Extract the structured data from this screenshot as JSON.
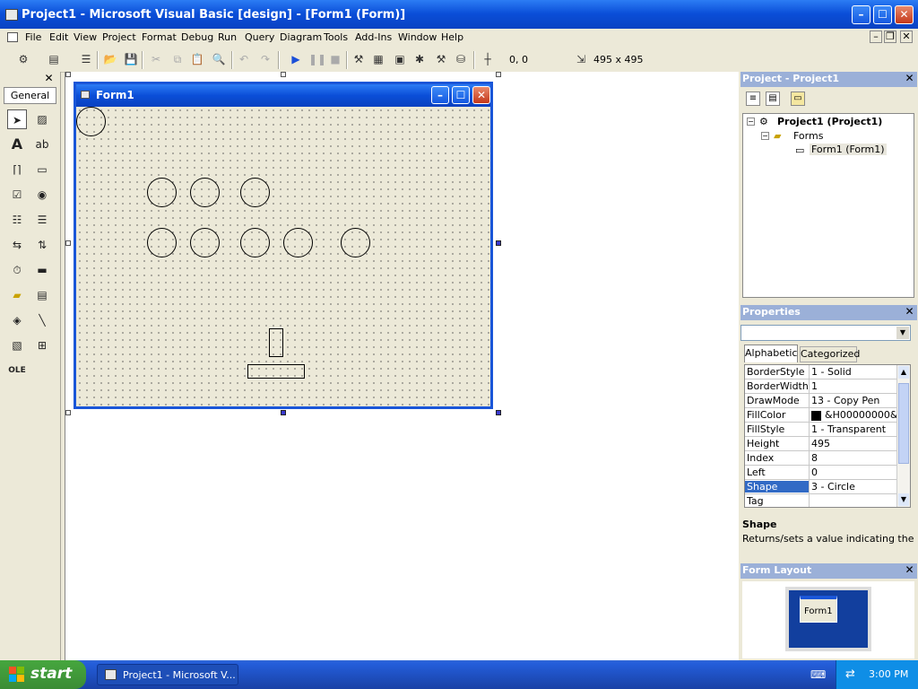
{
  "app": {
    "title": "Project1 - Microsoft Visual Basic [design] - [Form1 (Form)]",
    "minimize": "–",
    "maximize": "☐",
    "close": "✕"
  },
  "menubar": {
    "items": [
      "File",
      "Edit",
      "View",
      "Project",
      "Format",
      "Debug",
      "Run",
      "Query",
      "Diagram",
      "Tools",
      "Add-Ins",
      "Window",
      "Help"
    ],
    "mdi_controls": [
      "–",
      "❐",
      "✕"
    ]
  },
  "toolbar": {
    "position": "0, 0",
    "size": "495 x 495"
  },
  "toolbox": {
    "tab": "General",
    "close": "✕"
  },
  "form": {
    "title": "Form1",
    "minimize": "–",
    "maximize": "☐",
    "close": "✕"
  },
  "project_panel": {
    "title": "Project - Project1",
    "close": "✕",
    "root": "Project1 (Project1)",
    "folder": "Forms",
    "item": "Form1 (Form1)"
  },
  "properties_panel": {
    "title": "Properties",
    "close": "✕",
    "tabs": [
      "Alphabetic",
      "Categorized"
    ],
    "rows": [
      {
        "name": "BorderStyle",
        "value": "1 - Solid"
      },
      {
        "name": "BorderWidth",
        "value": "1"
      },
      {
        "name": "DrawMode",
        "value": "13 - Copy Pen"
      },
      {
        "name": "FillColor",
        "value": "&H00000000&"
      },
      {
        "name": "FillStyle",
        "value": "1 - Transparent"
      },
      {
        "name": "Height",
        "value": "495"
      },
      {
        "name": "Index",
        "value": "8"
      },
      {
        "name": "Left",
        "value": "0"
      },
      {
        "name": "Shape",
        "value": "3 - Circle"
      },
      {
        "name": "Tag",
        "value": ""
      }
    ],
    "selected_row": "Shape",
    "desc_title": "Shape",
    "desc_text": "Returns/sets a value indicating the"
  },
  "form_layout_panel": {
    "title": "Form Layout",
    "close": "✕",
    "preview_label": "Form1"
  },
  "taskbar": {
    "start": "start",
    "task": "Project1 - Microsoft V...",
    "clock": "3:00 PM"
  },
  "colors": {
    "xp_blue": "#0a4ed8",
    "selection": "#316ac5",
    "start_green": "#3b8c35"
  }
}
